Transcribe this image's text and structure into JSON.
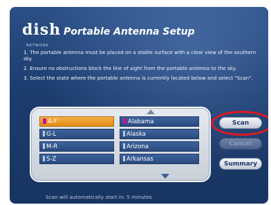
{
  "header": {
    "logo_text": "dish",
    "logo_subtext": "NETWORK",
    "title": "Portable Antenna Setup"
  },
  "instructions": [
    "1. The portable antenna must be placed on a stable surface with a clear view of the southern sky.",
    "2. Ensure no obstructions block the line of sight from the portable antenna to the sky.",
    "3. Select the state where the portable antenna is currently located below and select \"Scan\"."
  ],
  "picker": {
    "ranges": [
      {
        "label": "A-F",
        "selected": true
      },
      {
        "label": "G-L",
        "selected": false
      },
      {
        "label": "M-R",
        "selected": false
      },
      {
        "label": "S-Z",
        "selected": false
      }
    ],
    "states": [
      {
        "label": "Alabama",
        "highlighted": true
      },
      {
        "label": "Alaska",
        "highlighted": false
      },
      {
        "label": "Arizona",
        "highlighted": false
      },
      {
        "label": "Arkansas",
        "highlighted": false
      }
    ],
    "scroll_up_icon": "triangle-up",
    "scroll_down_icon": "triangle-down"
  },
  "buttons": {
    "scan": "Scan",
    "cancel": "Cancel",
    "summary": "Summary"
  },
  "footer": {
    "status_text": "Scan will automatically start in: 5 minutes"
  },
  "colors": {
    "background": "#1c3c6e",
    "selected_item": "#e08a17",
    "item": "#2a4b80",
    "highlight_ring": "#e3171f"
  }
}
